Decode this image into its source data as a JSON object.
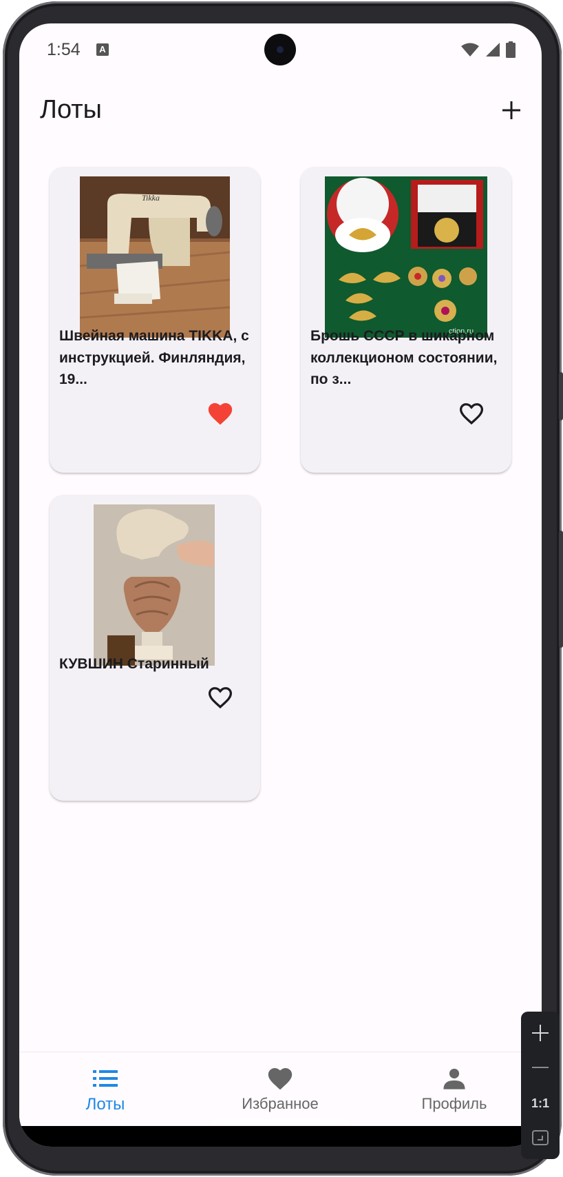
{
  "status_bar": {
    "time": "1:54",
    "indicator": "A"
  },
  "app_bar": {
    "title": "Лоты",
    "add_icon": "plus-icon"
  },
  "lots": [
    {
      "title": "Швейная машина TIKKA, с инструкцией. Финляндия, 19...",
      "favorite": true,
      "image": "sewing-machine-photo"
    },
    {
      "title": "Брошь СССР в шикарном коллекционом состоянии, по з...",
      "favorite": false,
      "image": "brooches-photo"
    },
    {
      "title": "КУВШИН Старинный",
      "favorite": false,
      "image": "jug-photo"
    }
  ],
  "bottom_nav": {
    "items": [
      {
        "label": "Лоты",
        "icon": "list-icon",
        "active": true
      },
      {
        "label": "Избранное",
        "icon": "heart-icon",
        "active": false
      },
      {
        "label": "Профиль",
        "icon": "person-icon",
        "active": false
      }
    ]
  },
  "zoom_controls": {
    "one_to_one": "1:1"
  },
  "colors": {
    "accent": "#1e88e5",
    "favorite": "#f44336",
    "card_bg": "#f4f1f6",
    "screen_bg": "#fffbfe"
  }
}
